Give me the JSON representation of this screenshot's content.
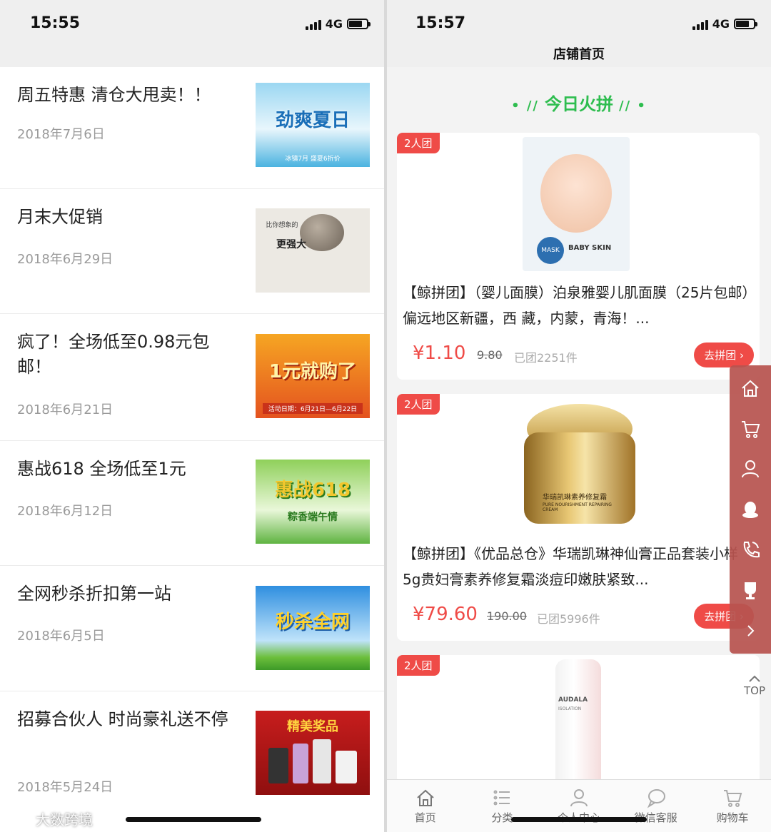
{
  "left": {
    "status": {
      "time": "15:55",
      "network": "4G"
    },
    "articles": [
      {
        "title": "周五特惠 清仓大甩卖！！",
        "date": "2018年7月6日",
        "thumb_text": "劲爽夏日",
        "thumb_sub": "冰镇7月 盛夏6折价",
        "thumb_theme": "summer"
      },
      {
        "title": "月末大促销",
        "date": "2018年6月29日",
        "thumb_text": "更强大",
        "thumb_sub": "比你想象的",
        "thumb_theme": "stone"
      },
      {
        "title": "疯了！全场低至0.98元包邮！",
        "date": "2018年6月21日",
        "thumb_text": "1元就购了",
        "thumb_sub": "活动日期：6月21日—6月22日",
        "thumb_theme": "orange"
      },
      {
        "title": "惠战618 全场低至1元",
        "date": "2018年6月12日",
        "thumb_text": "惠战618",
        "thumb_sub": "粽香端午情",
        "thumb_theme": "green"
      },
      {
        "title": "全网秒杀折扣第一站",
        "date": "2018年6月5日",
        "thumb_text": "秒杀全网",
        "thumb_sub": "",
        "thumb_theme": "sky"
      },
      {
        "title": "招募合伙人 时尚豪礼送不停",
        "date": "2018年5月24日",
        "thumb_text": "精美奖品",
        "thumb_sub": "",
        "thumb_theme": "red"
      }
    ],
    "watermark": "大数跨境"
  },
  "right": {
    "status": {
      "time": "15:57",
      "network": "4G"
    },
    "page_title": "店铺首页",
    "section_title": "今日火拼",
    "products": [
      {
        "badge": "2人团",
        "name": "【鲸拼团】（婴儿面膜）泊泉雅婴儿肌面膜（25片包邮）偏远地区新疆，西 藏，内蒙，青海！...",
        "price": "¥1.10",
        "old_price": "9.80",
        "sold": "已团2251件",
        "button": "去拼团",
        "img_label": "BABY SKIN",
        "img_sub": "MASK"
      },
      {
        "badge": "2人团",
        "name": "【鲸拼团】《优品总仓》华瑞凯琳神仙膏正品套装小样5g贵妇膏素养修复霜淡痘印嫩肤紧致...",
        "price": "¥79.60",
        "old_price": "190.00",
        "sold": "已团5996件",
        "button": "去拼团",
        "img_label": "华瑞凯琳素养修复霜",
        "img_sub": "PURE NOURISHMENT REPAIRING CREAM"
      },
      {
        "badge": "2人团",
        "img_label": "AUDALA",
        "img_sub": "ISOLATION"
      }
    ],
    "sidebar_icons": [
      "home-icon",
      "cart-icon",
      "user-icon",
      "qq-icon",
      "phone-icon",
      "cup-icon",
      "chevron-right-icon"
    ],
    "top_label": "TOP",
    "tabs": [
      {
        "label": "首页",
        "icon": "home-icon"
      },
      {
        "label": "分类",
        "icon": "list-icon"
      },
      {
        "label": "个人中心",
        "icon": "user-icon"
      },
      {
        "label": "微信客服",
        "icon": "chat-icon"
      },
      {
        "label": "购物车",
        "icon": "cart-icon"
      }
    ],
    "accent": "#ef4b47",
    "green": "#2ebd4f"
  }
}
